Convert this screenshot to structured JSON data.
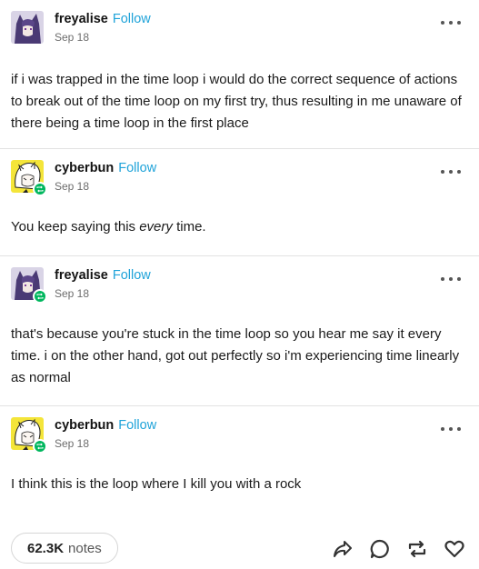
{
  "posts": [
    {
      "username": "freyalise",
      "follow_label": "Follow",
      "date": "Sep 18",
      "avatar": "purple-haired-character-avatar",
      "reblog_badge": false,
      "text": "if i was trapped in the time loop i would do the correct sequence of actions to break out of the time loop on my first try, thus resulting in me unaware of there being a time loop in the first place"
    },
    {
      "username": "cyberbun",
      "follow_label": "Follow",
      "date": "Sep 18",
      "avatar": "white-haired-character-yellow-avatar",
      "reblog_badge": true,
      "text_before": "You keep saying this ",
      "text_em": "every",
      "text_after": " time."
    },
    {
      "username": "freyalise",
      "follow_label": "Follow",
      "date": "Sep 18",
      "avatar": "purple-haired-character-avatar",
      "reblog_badge": true,
      "text": "that's because you're stuck in the time loop so you hear me say it every time. i on the other hand, got out perfectly so i'm experiencing time linearly as normal"
    },
    {
      "username": "cyberbun",
      "follow_label": "Follow",
      "date": "Sep 18",
      "avatar": "white-haired-character-yellow-avatar",
      "reblog_badge": true,
      "text": "I think this is the loop where I kill you with a rock"
    }
  ],
  "footer": {
    "notes_count": "62.3K",
    "notes_label": "notes",
    "icons": [
      "share-icon",
      "reply-icon",
      "reblog-icon",
      "like-icon"
    ]
  },
  "colors": {
    "follow": "#1fa3d9",
    "reblog_badge": "#00b75e",
    "divider": "#e2e2e2"
  }
}
